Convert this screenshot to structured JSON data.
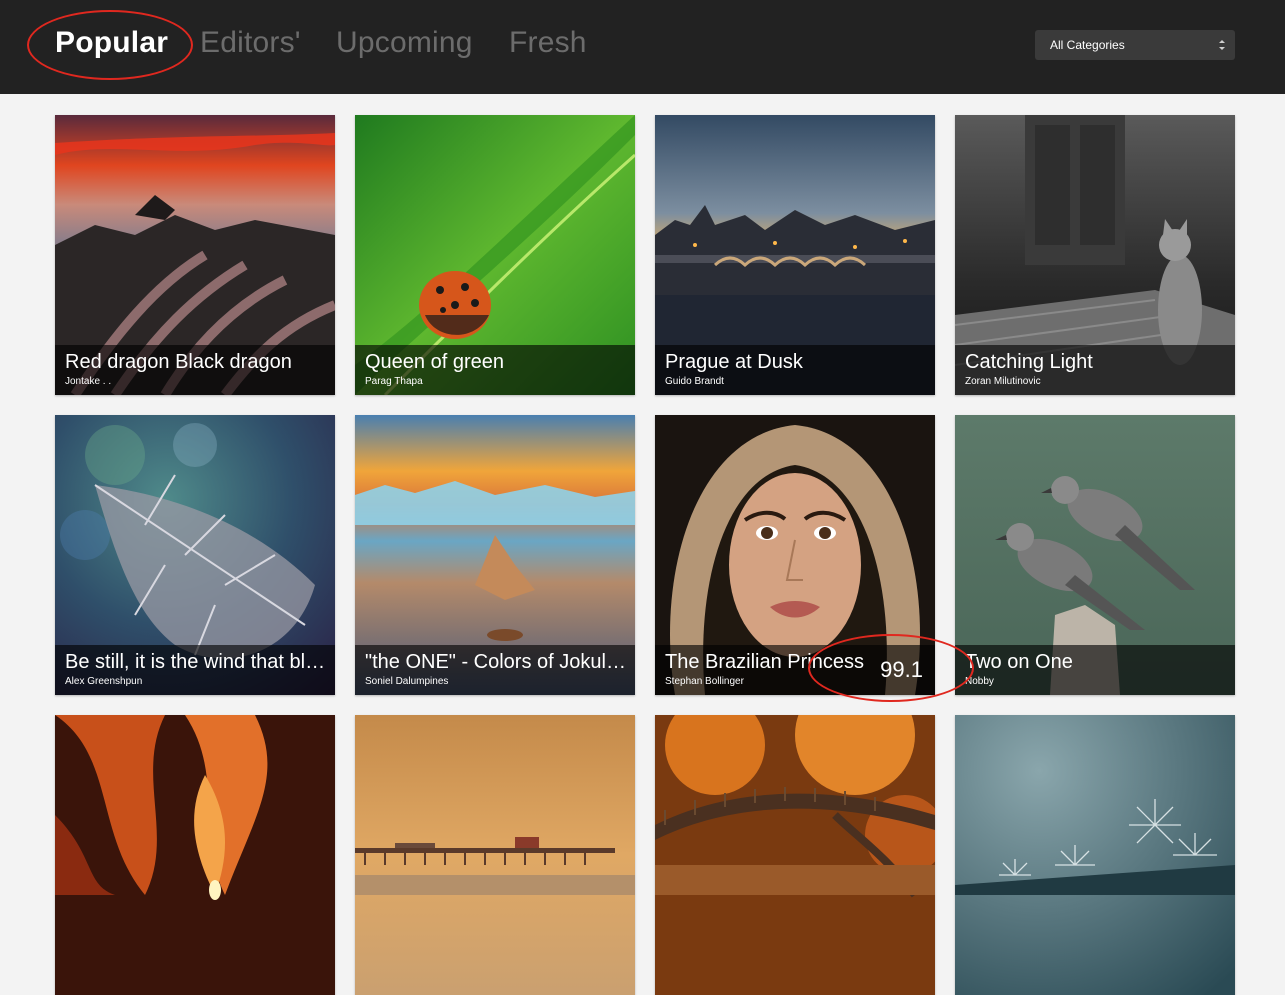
{
  "nav": {
    "tabs": [
      {
        "label": "Popular",
        "active": true
      },
      {
        "label": "Editors'",
        "active": false
      },
      {
        "label": "Upcoming",
        "active": false
      },
      {
        "label": "Fresh",
        "active": false
      }
    ],
    "category_select": {
      "selected": "All Categories"
    }
  },
  "photos": [
    {
      "title": "Red dragon Black dragon",
      "author": "Jontake . ."
    },
    {
      "title": "Queen of green",
      "author": "Parag Thapa"
    },
    {
      "title": "Prague at Dusk",
      "author": "Guido Brandt"
    },
    {
      "title": "Catching Light",
      "author": "Zoran Milutinovic"
    },
    {
      "title": "Be still, it is the wind that blows",
      "author": "Alex Greenshpun"
    },
    {
      "title": "\"the ONE\" - Colors of Jokulsarlon",
      "author": "Soniel Dalumpines"
    },
    {
      "title": "The Brazilian Princess",
      "author": "Stephan Bollinger",
      "rating": "99.1"
    },
    {
      "title": "Two on One",
      "author": "Nobby"
    },
    {
      "title": "",
      "author": ""
    },
    {
      "title": "",
      "author": ""
    },
    {
      "title": "",
      "author": ""
    },
    {
      "title": "",
      "author": ""
    }
  ],
  "colors": {
    "header_bg": "#222222",
    "tab_inactive": "#6c6c6c",
    "tab_active": "#ffffff",
    "annotation_red": "#e0281f",
    "page_bg": "#f3f3f3"
  }
}
